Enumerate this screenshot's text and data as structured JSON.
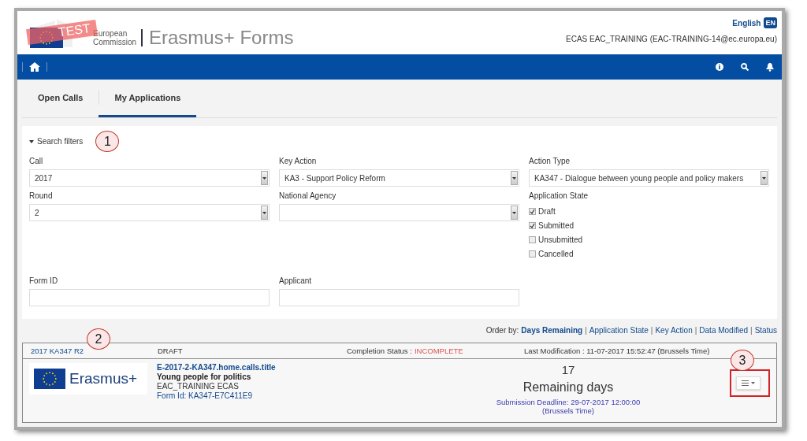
{
  "header": {
    "test_badge": "TEST",
    "org_name": [
      "European",
      "Commission"
    ],
    "app_title": "Erasmus+ Forms",
    "language": "English",
    "language_code": "EN",
    "user": "ECAS EAC_TRAINING (EAC-TRAINING-14@ec.europa.eu)"
  },
  "tabs": [
    {
      "label": "Open Calls",
      "selected": false
    },
    {
      "label": "My Applications",
      "selected": true
    }
  ],
  "search_filters": {
    "label": "Search filters",
    "expanded": true,
    "callout": "1",
    "fields": [
      {
        "kind": "select",
        "label": "Call",
        "value": "2017"
      },
      {
        "kind": "select",
        "label": "Key Action",
        "value": "KA3 - Support Policy Reform"
      },
      {
        "kind": "select",
        "label": "Action Type",
        "value": "KA347 - Dialogue between young people and policy makers"
      },
      {
        "kind": "select",
        "label": "Round",
        "value": "2"
      },
      {
        "kind": "select",
        "label": "National Agency"
      },
      {
        "kind": "checkboxes",
        "label": "Application State",
        "options": [
          {
            "label": "Draft",
            "checked": true
          },
          {
            "label": "Submitted",
            "checked": true
          },
          {
            "label": "Unsubmitted",
            "checked": false
          },
          {
            "label": "Cancelled",
            "checked": false
          }
        ]
      },
      {
        "kind": "text",
        "label": "Form ID"
      },
      {
        "kind": "text",
        "label": "Applicant"
      }
    ]
  },
  "order_by": {
    "label": "Order by:",
    "separator": "|",
    "options": [
      {
        "label": "Days Remaining",
        "selected": true
      },
      {
        "label": "Application State",
        "selected": false
      },
      {
        "label": "Key Action",
        "selected": false
      },
      {
        "label": "Data Modified",
        "selected": false
      },
      {
        "label": "Status",
        "selected": false
      }
    ]
  },
  "application": {
    "call": "2017 KA347 R2",
    "callout": "2",
    "state": "DRAFT",
    "completion_label": "Completion Status :",
    "completion_value": "INCOMPLETE",
    "last_modification": "Last Modification : 11-07-2017 15:52:47 (Brussels Time)",
    "logo_text": "Erasmus+",
    "title": "E-2017-2-KA347.home.calls.title",
    "subtitle": "Young people for politics",
    "applicant": "EAC_TRAINING ECAS",
    "form_id": "Form Id: KA347-E7C411E9",
    "days": "17",
    "days_label": "Remaining days",
    "deadline": "Submission Deadline: 29-07-2017 12:00:00 (Brussels Time)",
    "menu_callout": "3"
  }
}
